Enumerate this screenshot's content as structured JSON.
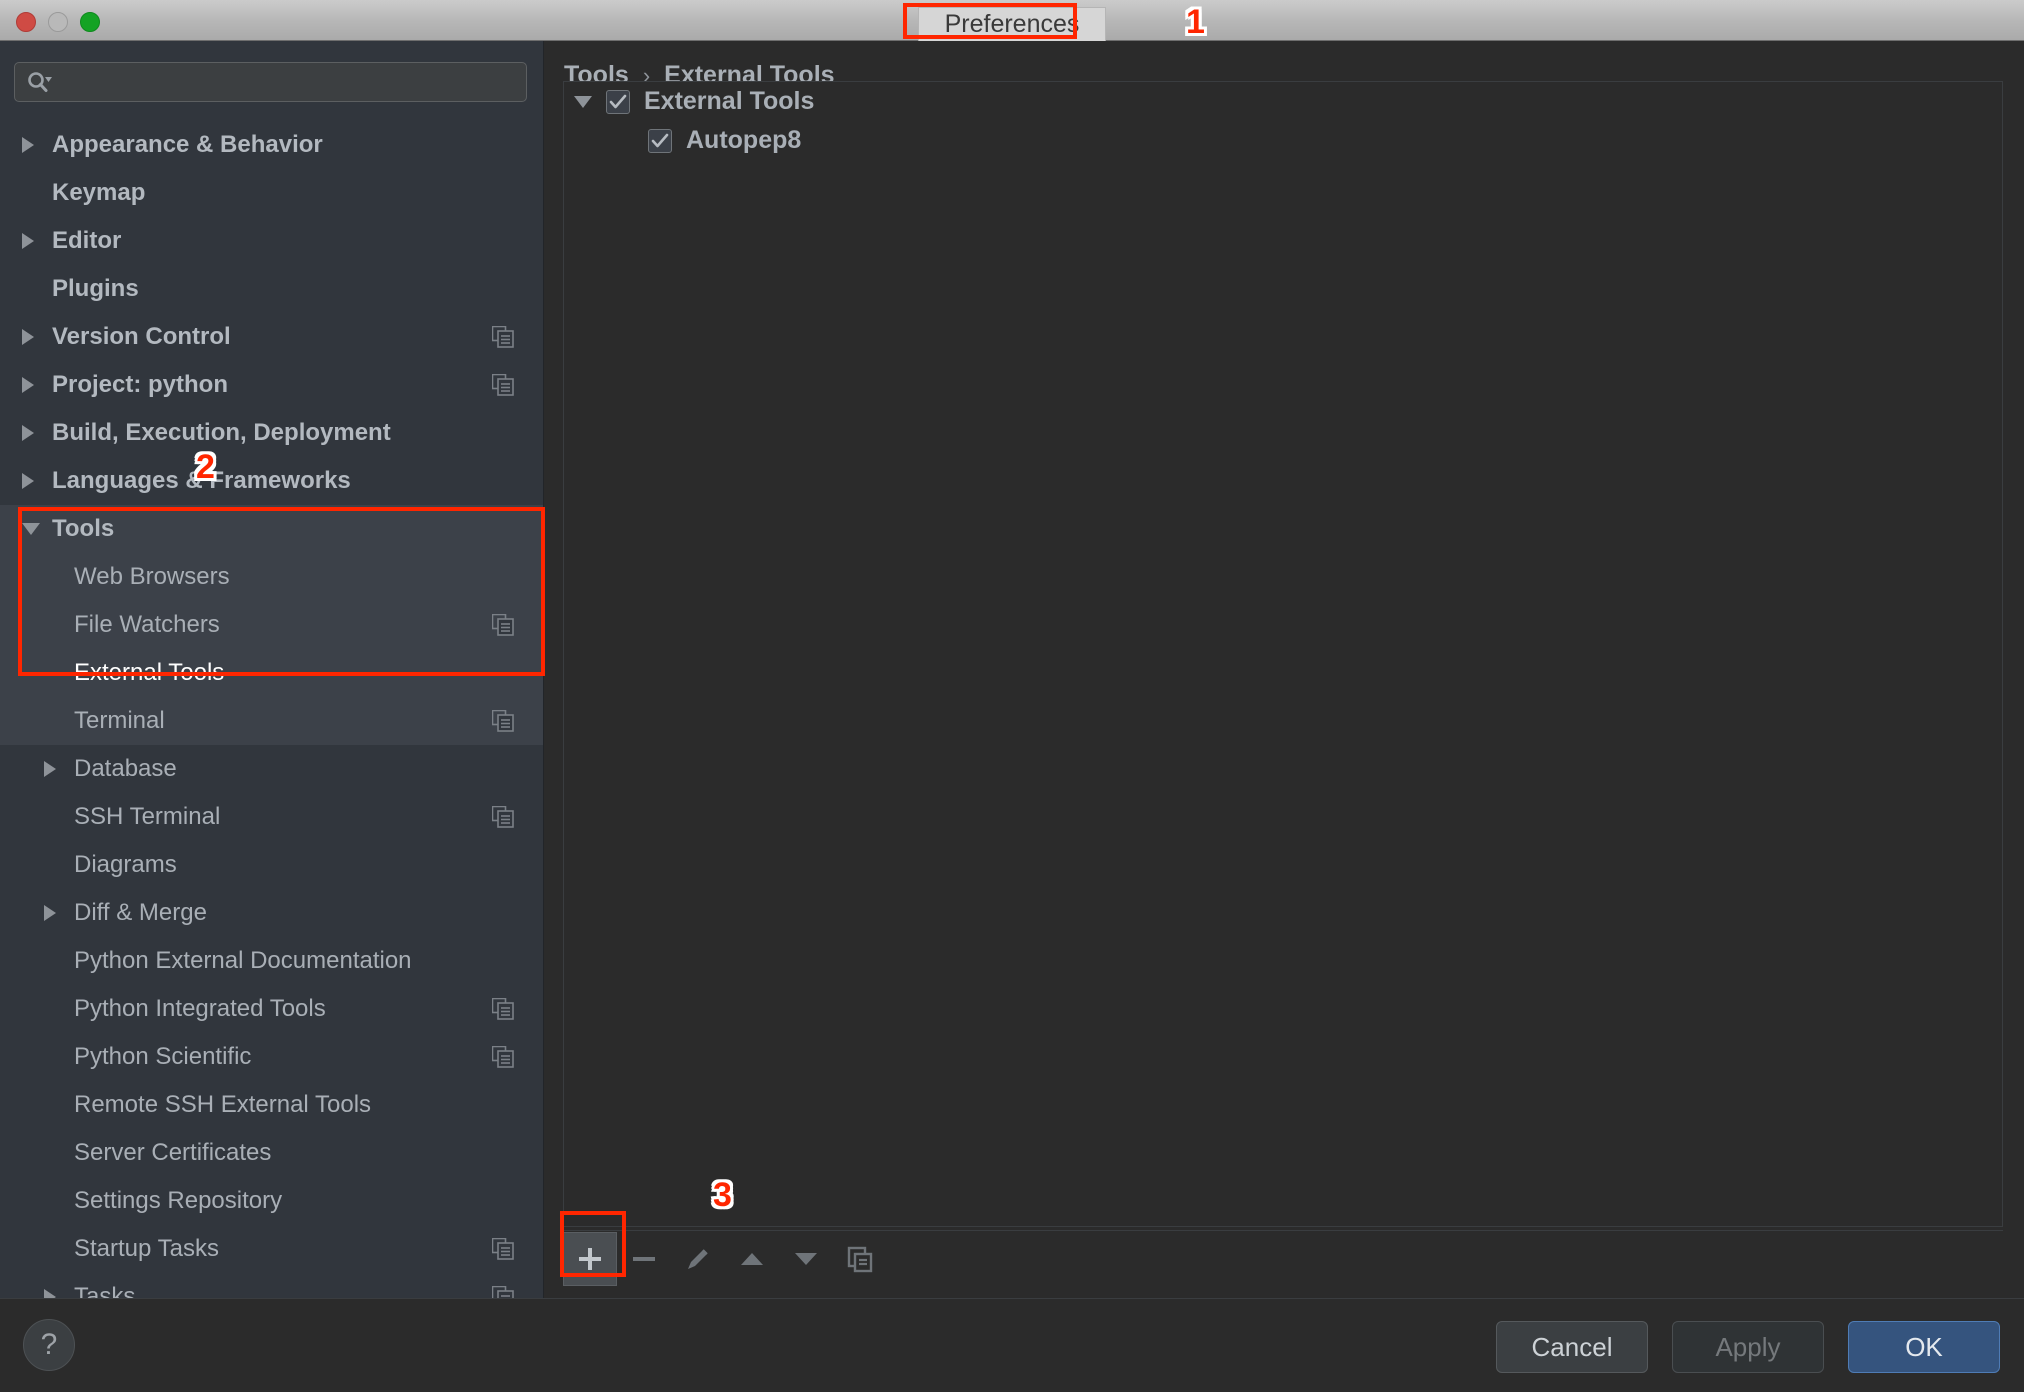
{
  "window": {
    "title": "Preferences",
    "controls": {
      "close": "close-button",
      "minimize": "minimize-button",
      "zoom": "zoom-button"
    }
  },
  "annotations": [
    {
      "number": "1",
      "target": "window-title"
    },
    {
      "number": "2",
      "target": "sidebar-tools-group"
    },
    {
      "number": "3",
      "target": "add-external-tool-button"
    }
  ],
  "sidebar": {
    "search": {
      "value": "",
      "placeholder": ""
    },
    "items": [
      {
        "label": "Appearance & Behavior",
        "level": 0,
        "arrow": "collapsed",
        "bold": true,
        "copy": false,
        "selected": false
      },
      {
        "label": "Keymap",
        "level": 0,
        "arrow": "none",
        "bold": true,
        "copy": false,
        "selected": false
      },
      {
        "label": "Editor",
        "level": 0,
        "arrow": "collapsed",
        "bold": true,
        "copy": false,
        "selected": false
      },
      {
        "label": "Plugins",
        "level": 0,
        "arrow": "none",
        "bold": true,
        "copy": false,
        "selected": false
      },
      {
        "label": "Version Control",
        "level": 0,
        "arrow": "collapsed",
        "bold": true,
        "copy": true,
        "selected": false
      },
      {
        "label": "Project: python",
        "level": 0,
        "arrow": "collapsed",
        "bold": true,
        "copy": true,
        "selected": false
      },
      {
        "label": "Build, Execution, Deployment",
        "level": 0,
        "arrow": "collapsed",
        "bold": true,
        "copy": false,
        "selected": false
      },
      {
        "label": "Languages & Frameworks",
        "level": 0,
        "arrow": "collapsed",
        "bold": true,
        "copy": false,
        "selected": false
      },
      {
        "label": "Tools",
        "level": 0,
        "arrow": "expanded",
        "bold": true,
        "copy": false,
        "selected": false,
        "group": true
      },
      {
        "label": "Web Browsers",
        "level": 1,
        "arrow": "none",
        "bold": false,
        "copy": false,
        "selected": false,
        "group": true
      },
      {
        "label": "File Watchers",
        "level": 1,
        "arrow": "none",
        "bold": false,
        "copy": true,
        "selected": false,
        "group": true
      },
      {
        "label": "External Tools",
        "level": 1,
        "arrow": "none",
        "bold": false,
        "copy": false,
        "selected": true,
        "group": true
      },
      {
        "label": "Terminal",
        "level": 1,
        "arrow": "none",
        "bold": false,
        "copy": true,
        "selected": false,
        "group": true
      },
      {
        "label": "Database",
        "level": 1,
        "arrow": "collapsed",
        "bold": false,
        "copy": false,
        "selected": false
      },
      {
        "label": "SSH Terminal",
        "level": 1,
        "arrow": "none",
        "bold": false,
        "copy": true,
        "selected": false
      },
      {
        "label": "Diagrams",
        "level": 1,
        "arrow": "none",
        "bold": false,
        "copy": false,
        "selected": false
      },
      {
        "label": "Diff & Merge",
        "level": 1,
        "arrow": "collapsed",
        "bold": false,
        "copy": false,
        "selected": false
      },
      {
        "label": "Python External Documentation",
        "level": 1,
        "arrow": "none",
        "bold": false,
        "copy": false,
        "selected": false
      },
      {
        "label": "Python Integrated Tools",
        "level": 1,
        "arrow": "none",
        "bold": false,
        "copy": true,
        "selected": false
      },
      {
        "label": "Python Scientific",
        "level": 1,
        "arrow": "none",
        "bold": false,
        "copy": true,
        "selected": false
      },
      {
        "label": "Remote SSH External Tools",
        "level": 1,
        "arrow": "none",
        "bold": false,
        "copy": false,
        "selected": false
      },
      {
        "label": "Server Certificates",
        "level": 1,
        "arrow": "none",
        "bold": false,
        "copy": false,
        "selected": false
      },
      {
        "label": "Settings Repository",
        "level": 1,
        "arrow": "none",
        "bold": false,
        "copy": false,
        "selected": false
      },
      {
        "label": "Startup Tasks",
        "level": 1,
        "arrow": "none",
        "bold": false,
        "copy": true,
        "selected": false
      },
      {
        "label": "Tasks",
        "level": 1,
        "arrow": "collapsed",
        "bold": false,
        "copy": true,
        "selected": false
      }
    ]
  },
  "main": {
    "breadcrumb": {
      "parent": "Tools",
      "separator": "›",
      "current": "External Tools"
    },
    "tree": [
      {
        "label": "External Tools",
        "checked": true,
        "arrow": "expanded",
        "indent": 0
      },
      {
        "label": "Autopep8",
        "checked": true,
        "arrow": "none",
        "indent": 1
      }
    ],
    "toolbar": [
      {
        "name": "add",
        "glyph": "+",
        "enabled": true,
        "highlighted": true
      },
      {
        "name": "remove",
        "glyph": "−",
        "enabled": false,
        "highlighted": false
      },
      {
        "name": "edit",
        "glyph": "pencil",
        "enabled": false,
        "highlighted": false
      },
      {
        "name": "move-up",
        "glyph": "up",
        "enabled": false,
        "highlighted": false
      },
      {
        "name": "move-down",
        "glyph": "down",
        "enabled": false,
        "highlighted": false
      },
      {
        "name": "copy",
        "glyph": "copy",
        "enabled": false,
        "highlighted": false
      }
    ]
  },
  "footer": {
    "help": "?",
    "cancel": "Cancel",
    "apply": "Apply",
    "ok": "OK"
  },
  "colors": {
    "accent_selection": "#2f65ca",
    "annotation_red": "#ff2600",
    "ok_button": "#35547e",
    "sidebar_bg": "#31363d",
    "main_bg": "#2b2b2b"
  }
}
